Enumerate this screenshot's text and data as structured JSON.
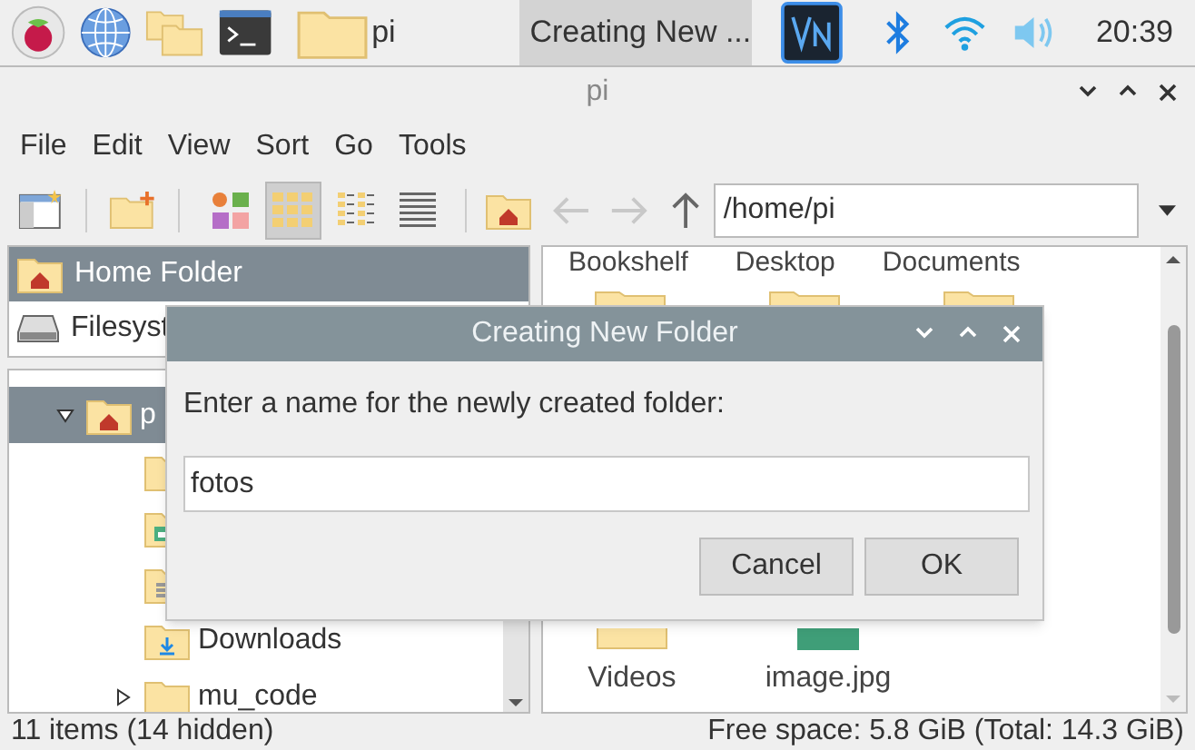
{
  "taskbar": {
    "tasks": [
      {
        "label": "pi",
        "selected": false
      },
      {
        "label": "Creating New ...",
        "selected": true
      }
    ],
    "clock": "20:39"
  },
  "window": {
    "title": "pi"
  },
  "menu": [
    "File",
    "Edit",
    "View",
    "Sort",
    "Go",
    "Tools"
  ],
  "toolbar": {
    "views": [
      {
        "kind": "thumbnail",
        "selected": false
      },
      {
        "kind": "icon",
        "selected": true
      },
      {
        "kind": "compact",
        "selected": false
      },
      {
        "kind": "list",
        "selected": false
      }
    ],
    "back_disabled": true,
    "forward_disabled": true,
    "path": "/home/pi"
  },
  "places": [
    {
      "label": "Home Folder",
      "kind": "home",
      "selected": true
    },
    {
      "label": "Filesyst",
      "kind": "drive",
      "selected": false
    }
  ],
  "tree": [
    {
      "label": "p",
      "kind": "home",
      "expanded": true,
      "selected": true,
      "children": [
        {
          "kind": "folder"
        },
        {
          "kind": "window"
        },
        {
          "kind": "list"
        },
        {
          "label": "Downloads",
          "kind": "download"
        },
        {
          "label": "mu_code",
          "kind": "folder",
          "expanded": false
        }
      ]
    }
  ],
  "files": {
    "top_labels": [
      "Bookshelf",
      "Desktop",
      "Documents"
    ],
    "bottom": [
      {
        "label": "Videos",
        "kind": "folder"
      },
      {
        "label": "image.jpg",
        "kind": "image"
      }
    ]
  },
  "dialog": {
    "title": "Creating New Folder",
    "prompt": "Enter a name for the newly created folder:",
    "value": "fotos",
    "buttons": [
      "Cancel",
      "OK"
    ]
  },
  "status_bar": {
    "items": "11 items (14 hidden)",
    "free": "Free space: 5.8 GiB (Total: 14.3 GiB)"
  }
}
